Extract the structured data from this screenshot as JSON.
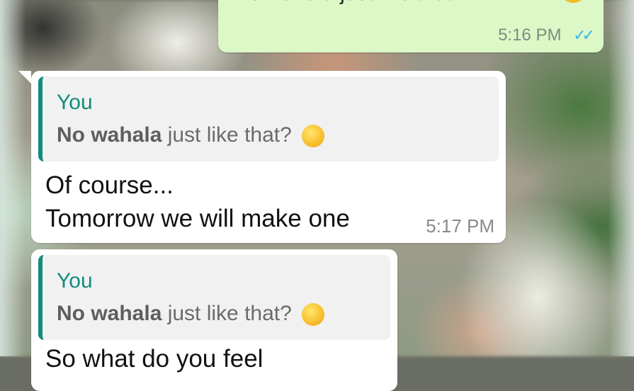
{
  "messages": [
    {
      "direction": "outgoing",
      "text": "No wahala just like that?",
      "time": "5:16 PM",
      "status_icon": "double-check-read-icon"
    },
    {
      "direction": "incoming",
      "quote": {
        "author": "You",
        "bold": "No wahala",
        "rest": " just like that?",
        "emoji": "smirk-emoji-icon"
      },
      "lines": [
        "Of course...",
        "Tomorrow we will make one"
      ],
      "time": "5:17 PM"
    },
    {
      "direction": "incoming",
      "quote": {
        "author": "You",
        "bold": "No wahala",
        "rest": " just like that?",
        "emoji": "smirk-emoji-icon"
      },
      "lines": [
        "So what do you feel"
      ]
    }
  ],
  "colors": {
    "outgoing_bubble": "#dcf8c6",
    "incoming_bubble": "#ffffff",
    "quote_accent": "#128c7e",
    "read_ticks": "#34b7f1"
  }
}
